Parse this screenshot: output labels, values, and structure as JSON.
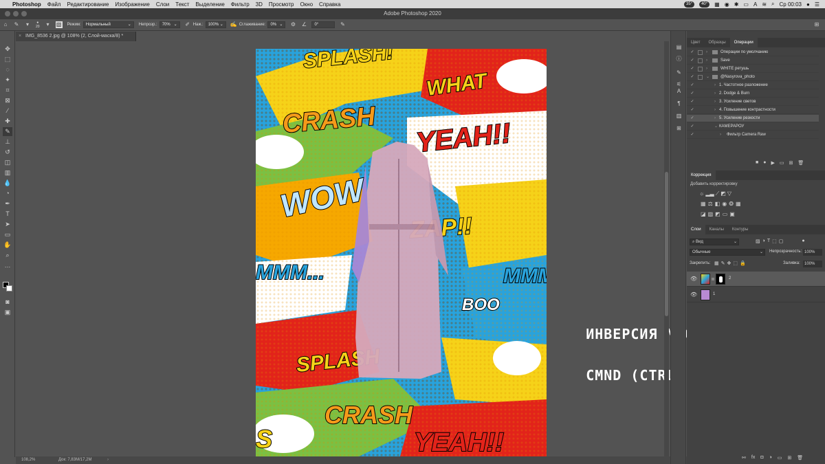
{
  "menubar": {
    "items": [
      "Photoshop",
      "Файл",
      "Редактирование",
      "Изображение",
      "Слои",
      "Текст",
      "Выделение",
      "Фильтр",
      "3D",
      "Просмотр",
      "Окно",
      "Справка"
    ],
    "badges": [
      "35°",
      "40°"
    ],
    "time": "Ср 00:03"
  },
  "window": {
    "title": "Adobe Photoshop 2020"
  },
  "options": {
    "brush_size": "20",
    "mode_label": "Режим:",
    "mode_value": "Нормальный",
    "opacity_label": "Непрозр.:",
    "opacity_value": "70%",
    "pressure_label": "Наж.:",
    "pressure_value": "100%",
    "smoothing_label": "Сглаживание:",
    "smoothing_value": "0%",
    "angle_value": "0°"
  },
  "document": {
    "tab_title": "IMG_8536 2.jpg @ 108% (2, Слой-маска/8) *",
    "zoom": "108,2%",
    "doc_info": "Док: 7,83M/17,2M"
  },
  "canvas_words": [
    "SPLASH!",
    "WHAT",
    "CRASH",
    "YEAH!!",
    "WOW",
    "ZAP!!",
    "MMM...",
    "MMM",
    "BOO",
    "SPLASH",
    "CRASH",
    "YEAH!!",
    "S"
  ],
  "captions": {
    "line1": "ИНВЕРСИЯ МАСКИ:",
    "line2": "CMND (CTRL) + I"
  },
  "actions_panel": {
    "tabs": [
      "Цвет",
      "Образцы",
      "Операции"
    ],
    "rows": [
      {
        "label": "Операции по умолчанию",
        "folder": true
      },
      {
        "label": "Save",
        "folder": true
      },
      {
        "label": "WHITE ретушь",
        "folder": true
      },
      {
        "label": "@Nasyrova_photo",
        "folder": true
      },
      {
        "label": "1. Частотное разложение",
        "folder": false
      },
      {
        "label": "2. Dodge & Burn",
        "folder": false
      },
      {
        "label": "3. Усиление светов",
        "folder": false
      },
      {
        "label": "4. Повышение контрастности",
        "folder": false
      },
      {
        "label": "5. Усиление резкости",
        "folder": false
      },
      {
        "label": "КАМЕРАРОУ",
        "folder": false
      },
      {
        "label": "Фильтр Camera Raw",
        "folder": false
      }
    ]
  },
  "adjustments_panel": {
    "tab": "Коррекция",
    "add_label": "Добавить корректировку"
  },
  "layers_panel": {
    "tabs": [
      "Слои",
      "Каналы",
      "Контуры"
    ],
    "filter_value": "Вид",
    "blend_value": "Обычные",
    "opacity_label": "Непрозрачность:",
    "opacity_value": "100%",
    "lock_label": "Закрепить:",
    "fill_label": "Заливка:",
    "fill_value": "100%",
    "layers": [
      {
        "name": "2",
        "selected": true
      },
      {
        "name": "1",
        "selected": false
      }
    ]
  },
  "colors": {
    "ui_dark": "#535353",
    "panel": "#424242",
    "accent_yellow": "#f6d219",
    "accent_red": "#e2231a",
    "coat_pink": "#d6a9bc"
  }
}
